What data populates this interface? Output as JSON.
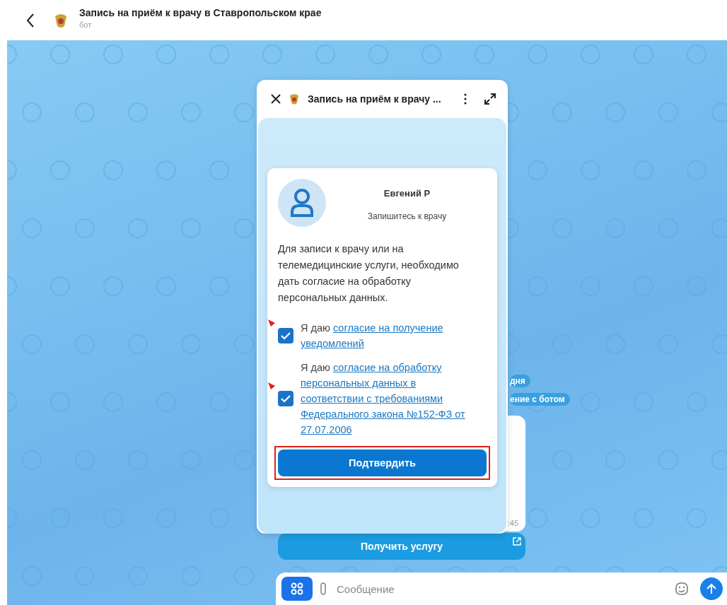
{
  "header": {
    "title": "Запись на приём к врачу в Ставропольском крае",
    "subtitle": "бот"
  },
  "chat": {
    "date_pill": "дня",
    "service_pill": "ение с ботом",
    "message_time": ":45",
    "action_button": "Получить услугу"
  },
  "composer": {
    "placeholder": "Сообщение"
  },
  "webapp": {
    "title": "Запись на приём к врачу ...",
    "card": {
      "name": "Евгений Р",
      "subtitle": "Запишитесь к врачу",
      "text": "Для записи к врачу или на телемедицинские услуги, необходимо дать согласие на обработку персональных данных.",
      "consents": [
        {
          "prefix": "Я даю",
          "link_lines": [
            "согласие на получение",
            "уведомлений"
          ],
          "checked": true,
          "annotated": true
        },
        {
          "prefix": "Я даю",
          "link_lines": [
            "согласие на обработку",
            "персональных данных в",
            "соответствии с требованиями",
            "Федерального закона №152-ФЗ от",
            "27.07.2006"
          ],
          "checked": true,
          "annotated": true
        }
      ],
      "confirm": {
        "label": "Подтвердить",
        "highlighted": true
      }
    }
  }
}
